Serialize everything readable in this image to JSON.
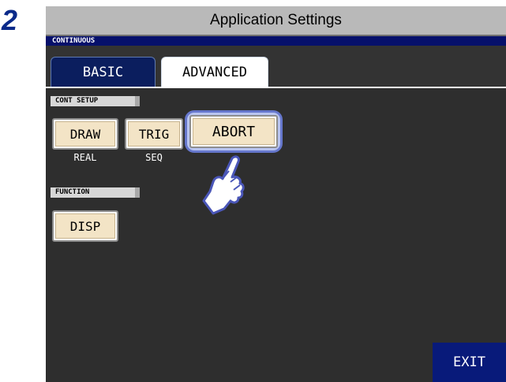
{
  "step_number": "2",
  "header": {
    "title": "Application Settings"
  },
  "screen": {
    "subtitle": "CONTINUOUS",
    "tabs": [
      {
        "label": "BASIC",
        "active": false
      },
      {
        "label": "ADVANCED",
        "active": true
      }
    ],
    "cont_setup": {
      "section_label": "CONT SETUP",
      "buttons": [
        {
          "label": "DRAW",
          "value": "REAL"
        },
        {
          "label": "TRIG",
          "value": "SEQ"
        },
        {
          "label": "ABORT",
          "value": ""
        }
      ]
    },
    "function": {
      "section_label": "FUNCTION",
      "buttons": [
        {
          "label": "DISP"
        }
      ]
    },
    "exit_label": "EXIT"
  },
  "colors": {
    "header_gray": "#b9b9b9",
    "subtitle_bar": "#06106b",
    "screen_bg": "#2e2e2e",
    "button_face": "#f3e4c6",
    "highlight": "#6677cc",
    "exit_bg": "#081a7a"
  },
  "icons": {
    "pointer": "hand-pointer-icon"
  }
}
